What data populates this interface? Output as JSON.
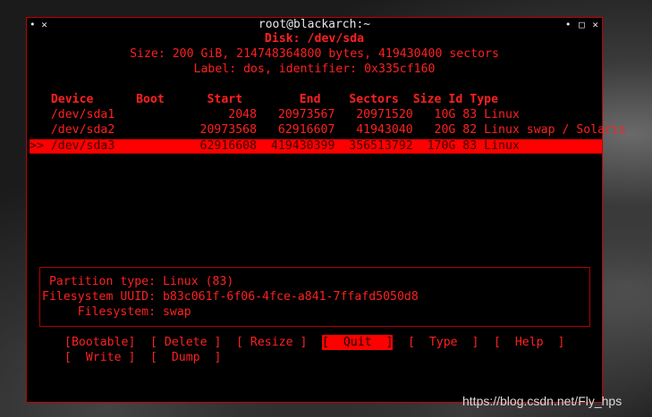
{
  "window": {
    "title": "root@blackarch:~",
    "left_controls": "• ✕",
    "right_controls": "• □ ✕"
  },
  "disk": {
    "heading": "Disk: /dev/sda",
    "size_line": "Size: 200 GiB, 214748364800 bytes, 419430400 sectors",
    "label_line": "Label: dos, identifier: 0x335cf160"
  },
  "table": {
    "header_line": "   Device      Boot      Start        End    Sectors  Size Id Type",
    "rows": [
      {
        "line": "   /dev/sda1                2048   20973567   20971520   10G 83 Linux"
      },
      {
        "line": "   /dev/sda2            20973568   62916607   41943040   20G 82 Linux swap / Solaris"
      },
      {
        "line": ">> /dev/sda3            62916608  419430399  356513792  170G 83 Linux"
      }
    ]
  },
  "info": {
    "partition_type": " Partition type: Linux (83)",
    "uuid": "Filesystem UUID: b83c061f-6f06-4fce-a841-7ffafd5050d8",
    "filesystem": "     Filesystem: swap"
  },
  "menu": {
    "bootable": "[Bootable]",
    "delete": "[ Delete ]",
    "resize": "[ Resize ]",
    "quit": "[  Quit  ]",
    "type": "[  Type  ]",
    "help": "[  Help  ]",
    "write": "[  Write ]",
    "dump": "[  Dump  ]"
  },
  "watermark": "https://blog.csdn.net/Fly_hps"
}
